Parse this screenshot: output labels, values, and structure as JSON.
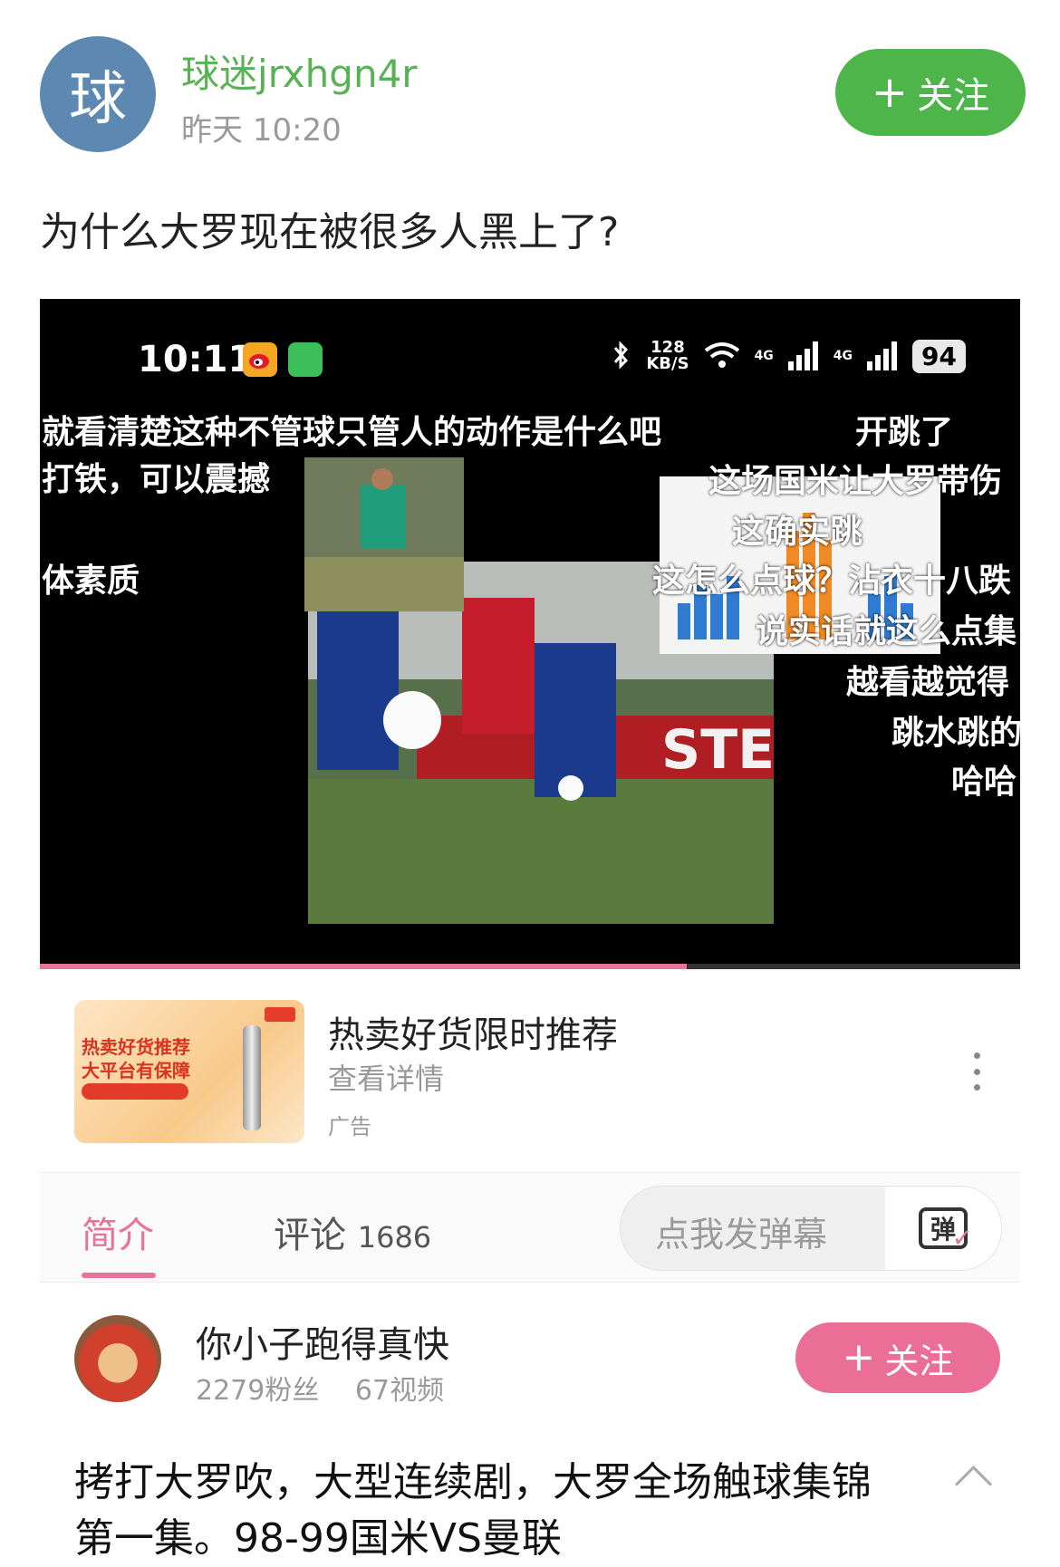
{
  "post": {
    "avatar_char": "球",
    "username": "球迷jrxhgn4r",
    "time": "昨天 10:20",
    "follow_label": "关注",
    "title": "为什么大罗现在被很多人黑上了?"
  },
  "video": {
    "status_time": "10:11",
    "net_speed_top": "128",
    "net_speed_bottom": "KB/S",
    "signal1": "4G",
    "signal2": "4G",
    "battery": "94",
    "captions": [
      "就看清楚这种不管球只管人的动作是什么吧",
      "开跳了",
      "打铁，可以震撼",
      "这场国米让大罗带伤",
      "这确实跳",
      "体素质",
      "这怎么点球？沾衣十八跌",
      "说实话就这么点集",
      "越看越觉得",
      "跳水跳的",
      "哈哈"
    ],
    "progress": 0.66,
    "colors": {
      "progress": "#e8739a"
    }
  },
  "ad": {
    "thumb_line1": "热卖好货推荐",
    "thumb_line2": "大平台有保障",
    "title": "热卖好货限时推荐",
    "link": "查看详情",
    "label": "广告"
  },
  "tabs": {
    "intro": "简介",
    "comments": "评论",
    "comments_count": "1686",
    "danmaku_placeholder": "点我发弹幕",
    "danmaku_icon": "弹"
  },
  "uploader": {
    "name": "你小子跑得真快",
    "fans": "2279粉丝",
    "videos": "67视频",
    "follow_label": "关注"
  },
  "video_title": "拷打大罗吹，大型连续剧，大罗全场触球集锦第一集。98-99国米VS曼联",
  "theme": {
    "green": "#4db54a",
    "pink": "#ea6e95"
  }
}
